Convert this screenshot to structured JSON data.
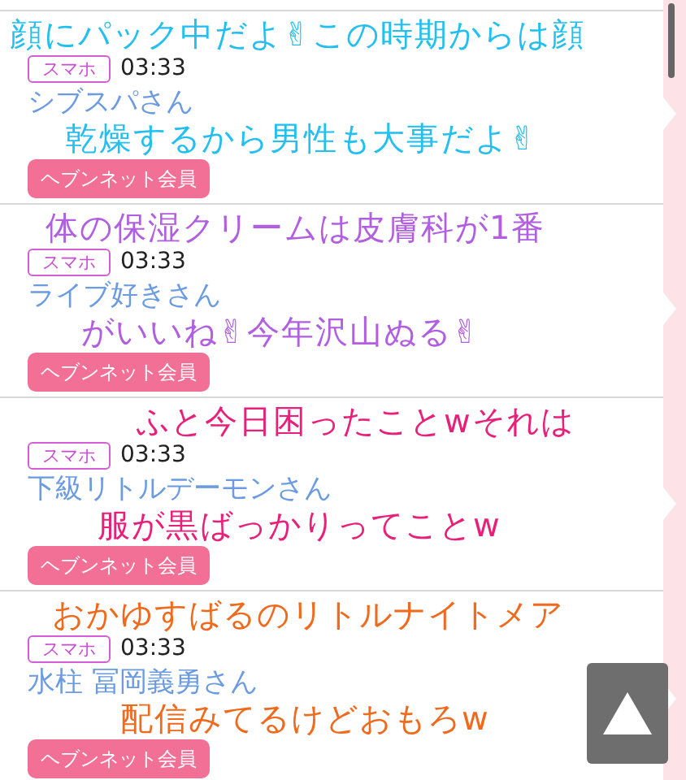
{
  "comments": [
    {
      "device": "スマホ",
      "time": "03:33",
      "name": "シブスパさん",
      "member_button": "ヘブンネット会員",
      "caption": {
        "color": "#22bff0",
        "lines": [
          "顔にパック中だよ✌この時期からは顔",
          "乾燥するから男性も大事だよ✌"
        ]
      }
    },
    {
      "device": "スマホ",
      "time": "03:33",
      "name": "ライブ好きさん",
      "member_button": "ヘブンネット会員",
      "caption": {
        "color": "#b15ee0",
        "lines": [
          "体の保湿クリームは皮膚科が1番",
          "がいいね✌今年沢山ぬる✌"
        ]
      }
    },
    {
      "device": "スマホ",
      "time": "03:33",
      "name": "下級リトルデーモンさん",
      "member_button": "ヘブンネット会員",
      "caption": {
        "color": "#e8207a",
        "lines": [
          "ふと今日困ったことwそれは",
          "服が黒ばっかりってことw"
        ]
      }
    },
    {
      "device": "スマホ",
      "time": "03:33",
      "name": "水柱 冨岡義勇さん",
      "member_button": "ヘブンネット会員",
      "caption": {
        "color": "#f06a1e",
        "lines": [
          "おかゆすばるのリトルナイトメア",
          "配信みてるけどおもろw"
        ]
      }
    }
  ]
}
